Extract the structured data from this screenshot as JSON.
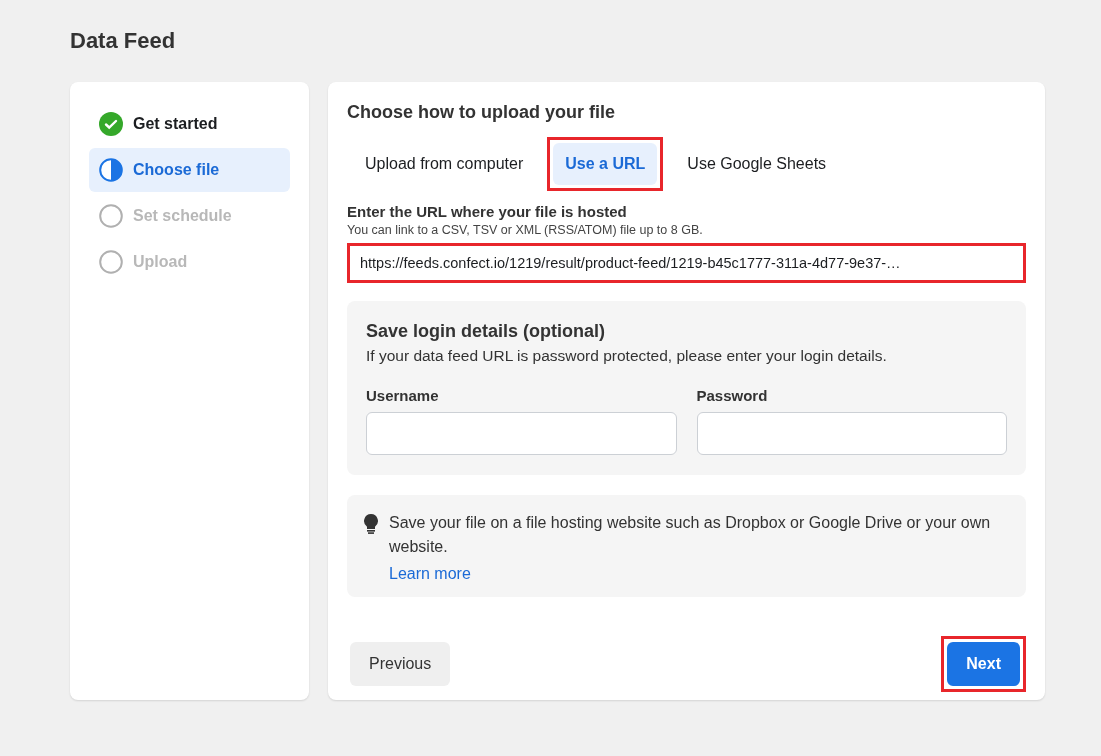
{
  "page": {
    "title": "Data Feed"
  },
  "steps": [
    {
      "label": "Get started",
      "kind": "done",
      "selected": false
    },
    {
      "label": "Choose file",
      "kind": "current",
      "selected": true
    },
    {
      "label": "Set schedule",
      "kind": "pending",
      "selected": false
    },
    {
      "label": "Upload",
      "kind": "pending",
      "selected": false
    }
  ],
  "upload": {
    "heading": "Choose how to upload your file",
    "tabs": [
      {
        "label": "Upload from computer",
        "selected": false,
        "highlighted": false
      },
      {
        "label": "Use a URL",
        "selected": true,
        "highlighted": true
      },
      {
        "label": "Use Google Sheets",
        "selected": false,
        "highlighted": false
      }
    ],
    "url_label": "Enter the URL where your file is hosted",
    "url_hint": "You can link to a CSV, TSV or XML (RSS/ATOM) file up to 8 GB.",
    "url_field": {
      "value": "https://feeds.confect.io/1219/result/product-feed/1219-b45c1777-311a-4d77-9e37-…",
      "highlighted": true
    },
    "login": {
      "heading": "Save login details (optional)",
      "description": "If your data feed URL is password protected, please enter your login details.",
      "fields": [
        {
          "label": "Username"
        },
        {
          "label": "Password"
        }
      ]
    },
    "tip": {
      "text": "Save your file on a file hosting website such as Dropbox or Google Drive or your own website.",
      "link": "Learn more"
    },
    "buttons": [
      {
        "label": "Previous",
        "kind": "secondary",
        "highlighted": false
      },
      {
        "label": "Next",
        "kind": "primary",
        "highlighted": true
      }
    ]
  }
}
